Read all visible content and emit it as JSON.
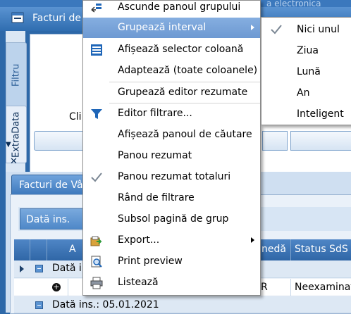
{
  "background": {
    "window_title": "Facturi de V",
    "top_right_text": "a electronica",
    "side_tabs": [
      "Filtru",
      "ExtraData"
    ],
    "filter_panel_text": "Cli",
    "lower_tab_label": "Facturi de Vân",
    "group_chip_label": "Dată ins.",
    "grid_headers": {
      "col_a": "A",
      "col_moneda": "nedă",
      "col_status": "Status SdS"
    },
    "rows": {
      "row1_text": "Dată in",
      "row2_cell_r": "R",
      "row2_status": "Neexaminat",
      "row3_text": "Dată ins.: 05.01.2021"
    }
  },
  "context_menu": {
    "items": [
      {
        "label": "Ascunde panoul grupului",
        "icon": "hide-group-panel-icon"
      },
      {
        "label": "Grupează interval",
        "has_submenu": true,
        "selected": true
      },
      {
        "label": "Afișează selector coloană",
        "icon": "column-chooser-icon"
      },
      {
        "label": "Adaptează (toate coloanele)"
      },
      {
        "label": "Grupează editor rezumate"
      },
      {
        "label": "Editor filtrare...",
        "icon": "filter-funnel-icon"
      },
      {
        "label": "Afișează panoul de căutare"
      },
      {
        "label": "Panou rezumat"
      },
      {
        "label": "Panou rezumat totaluri",
        "checked": true
      },
      {
        "label": "Rând de filtrare"
      },
      {
        "label": "Subsol pagină de grup"
      },
      {
        "label": "Export...",
        "icon": "export-icon",
        "has_submenu": true
      },
      {
        "label": "Print preview",
        "icon": "print-preview-icon"
      },
      {
        "label": "Listează",
        "icon": "printer-icon"
      }
    ]
  },
  "submenu": {
    "items": [
      {
        "label": "Nici unul",
        "checked": true
      },
      {
        "label": "Ziua"
      },
      {
        "label": "Lună"
      },
      {
        "label": "An"
      },
      {
        "label": "Inteligent"
      }
    ]
  },
  "colors": {
    "menu_highlight": "#7aa3d9",
    "header_blue": "#2f66a6",
    "accent_icon_blue": "#1f66b8"
  }
}
